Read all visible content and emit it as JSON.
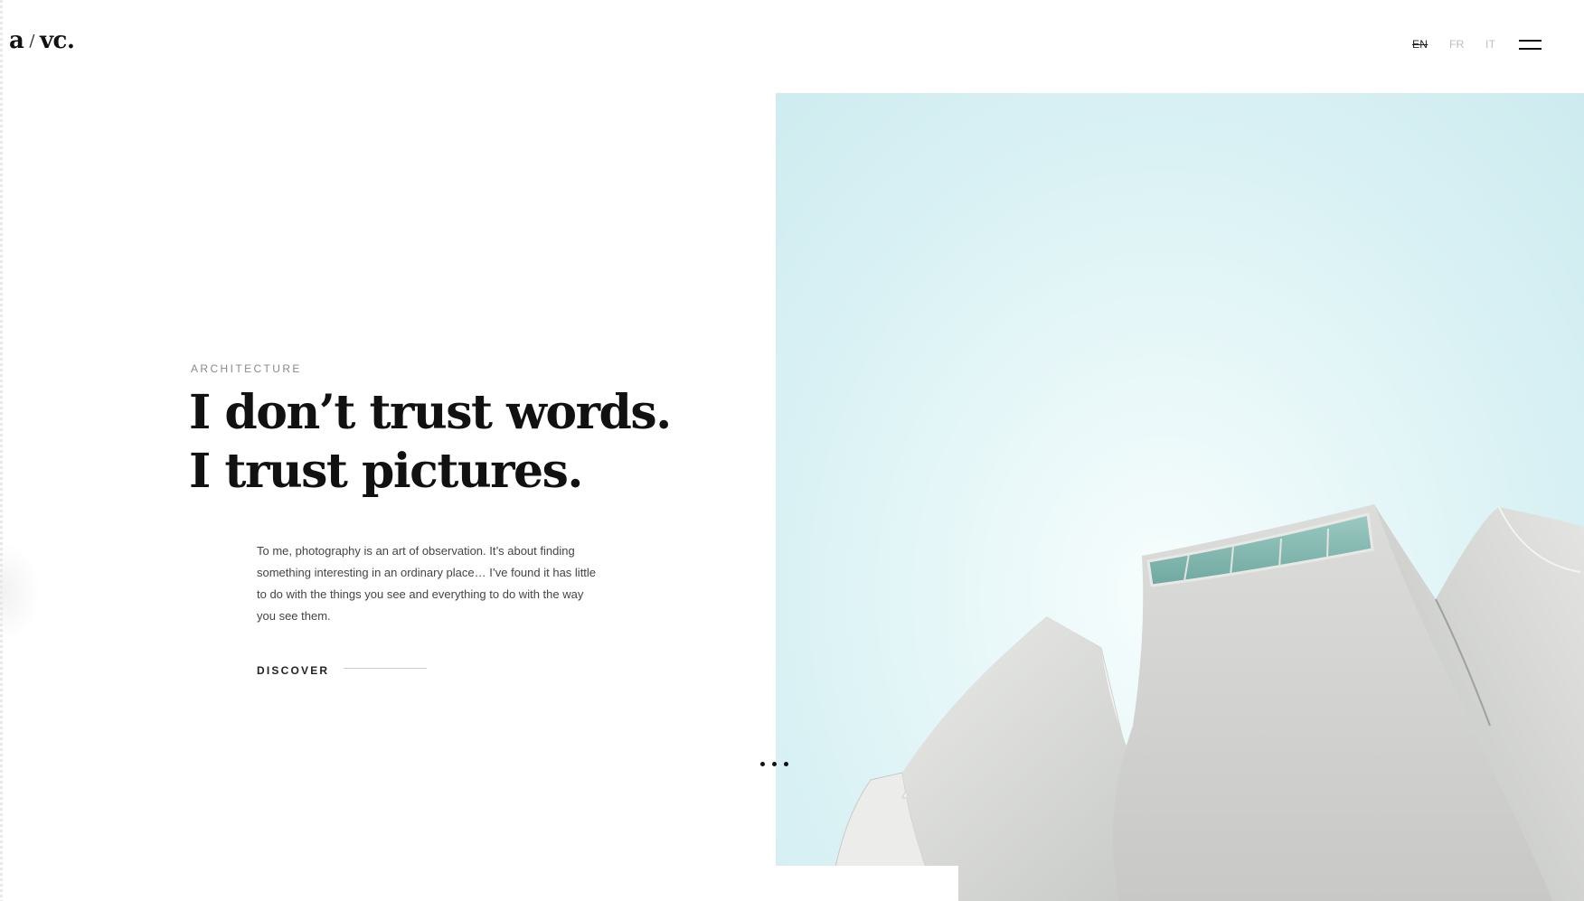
{
  "header": {
    "logo_left": "a",
    "logo_slash": "/",
    "logo_right": "vc.",
    "languages": [
      {
        "code": "EN",
        "active": true
      },
      {
        "code": "FR",
        "active": false
      },
      {
        "code": "IT",
        "active": false
      }
    ],
    "menu_icon": "hamburger-icon"
  },
  "hero": {
    "category": "ARCHITECTURE",
    "headline_line1": "I don’t trust words.",
    "headline_line2": "I trust pictures.",
    "body": "To me, photography is an art of observation. It’s about finding something interesting in an ordinary place… I’ve found it has little to do with the things you see and everything to do with the way you see them.",
    "cta_label": "DISCOVER",
    "more_icon": "ellipsis-icon"
  },
  "image": {
    "subject": "white petal-shaped building against pale cyan sky",
    "sky_color": "#d9f1f4",
    "building_color": "#d8d9d7",
    "window_color": "#7fb6ae"
  }
}
